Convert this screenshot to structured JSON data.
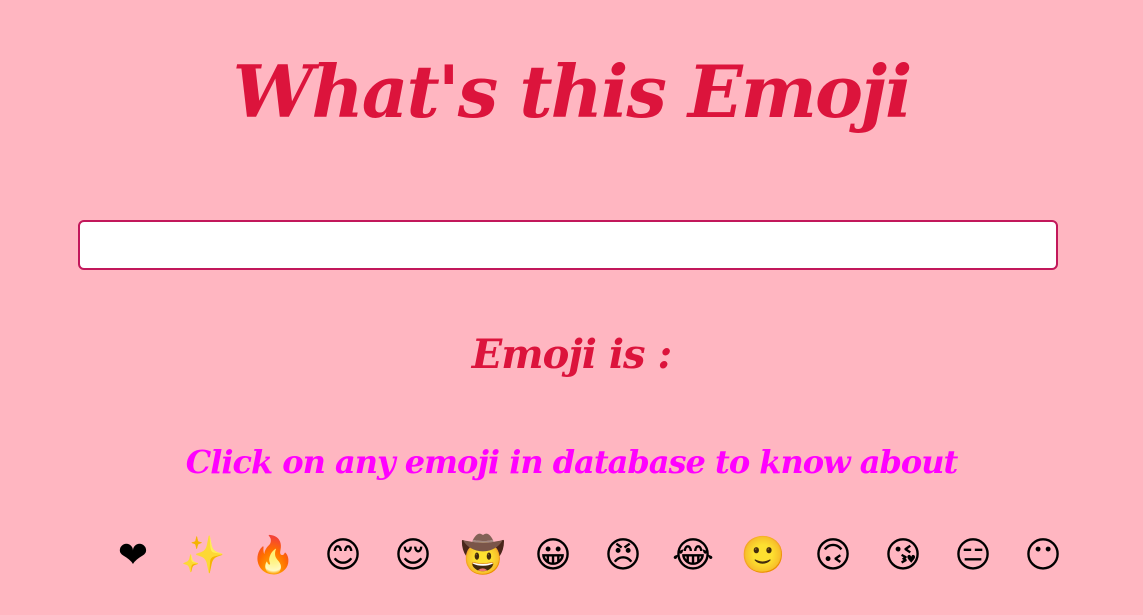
{
  "colors": {
    "background": "#FFB6C1",
    "title": "#DC143C",
    "hint": "#FF00FF",
    "input_border": "#C2185B"
  },
  "title": "What's this Emoji",
  "search": {
    "value": "",
    "placeholder": ""
  },
  "result_label": "Emoji is :",
  "hint": "Click on any emoji in database to know about",
  "emojis": [
    "❤",
    "✨",
    "🔥",
    "😊",
    "😌",
    "🤠",
    "😀",
    "😠",
    "😂",
    "🙂",
    "🙃",
    "😘",
    "😑",
    "😶"
  ]
}
